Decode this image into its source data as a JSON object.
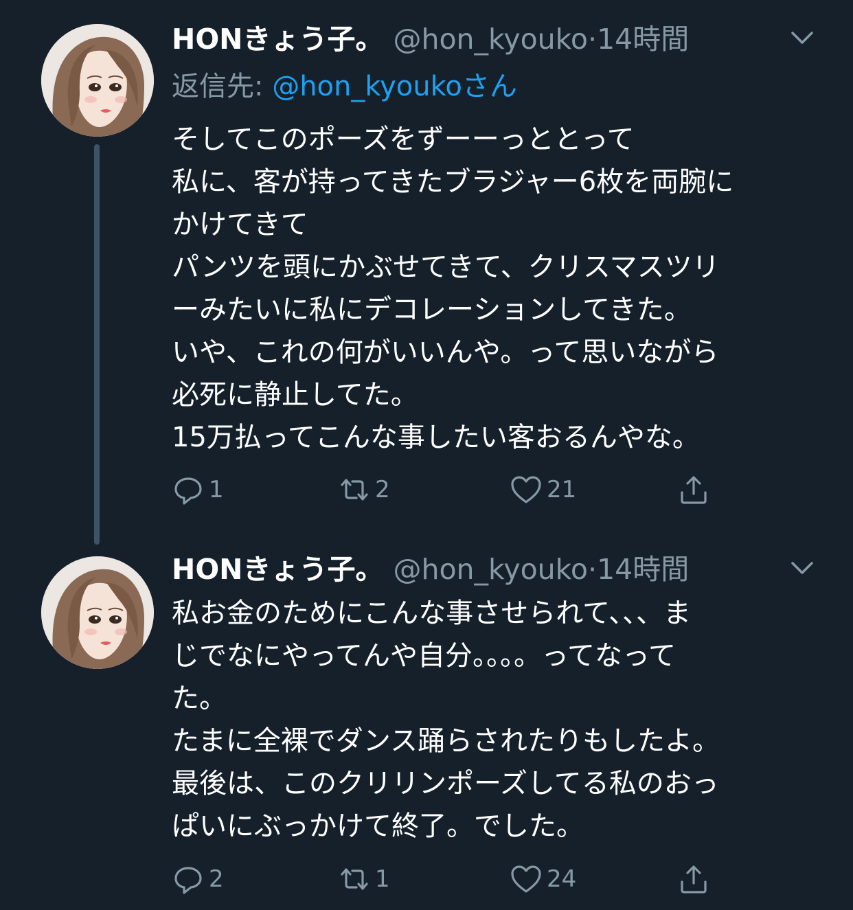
{
  "colors": {
    "background": "#15202b",
    "text_primary": "#ffffff",
    "text_secondary": "#8899a6",
    "link": "#1da1f2",
    "thread_line": "#3d5466"
  },
  "tweets": [
    {
      "display_name": "HONきょう子。",
      "handle": "@hon_kyouko",
      "separator": "·",
      "time": "14時間",
      "reply_prefix": "返信先: ",
      "reply_to": "@hon_kyoukoさん",
      "body_lines": [
        "そしてこのポーズをずーーっととって",
        "私に、客が持ってきたブラジャー6枚を両腕に",
        "かけてきて",
        "パンツを頭にかぶせてきて、クリスマスツリ",
        "ーみたいに私にデコレーションしてきた。",
        "いや、これの何がいいんや。って思いながら",
        "必死に静止してた。",
        "15万払ってこんな事したい客おるんやな。"
      ],
      "actions": {
        "reply_count": "1",
        "retweet_count": "2",
        "like_count": "21"
      },
      "icons": [
        "avatar",
        "chevron-down-icon",
        "reply-icon",
        "retweet-icon",
        "like-icon",
        "share-icon"
      ]
    },
    {
      "display_name": "HONきょう子。",
      "handle": "@hon_kyouko",
      "separator": "·",
      "time": "14時間",
      "body_lines": [
        "私お金のためにこんな事させられて、、、ま",
        "じでなにやってんや自分。。。。ってなって",
        "た。",
        "たまに全裸でダンス踊らされたりもしたよ。",
        "最後は、このクリリンポーズしてる私のおっ",
        "ぱいにぶっかけて終了。でした。"
      ],
      "actions": {
        "reply_count": "2",
        "retweet_count": "1",
        "like_count": "24"
      },
      "icons": [
        "avatar",
        "chevron-down-icon",
        "reply-icon",
        "retweet-icon",
        "like-icon",
        "share-icon"
      ]
    }
  ]
}
